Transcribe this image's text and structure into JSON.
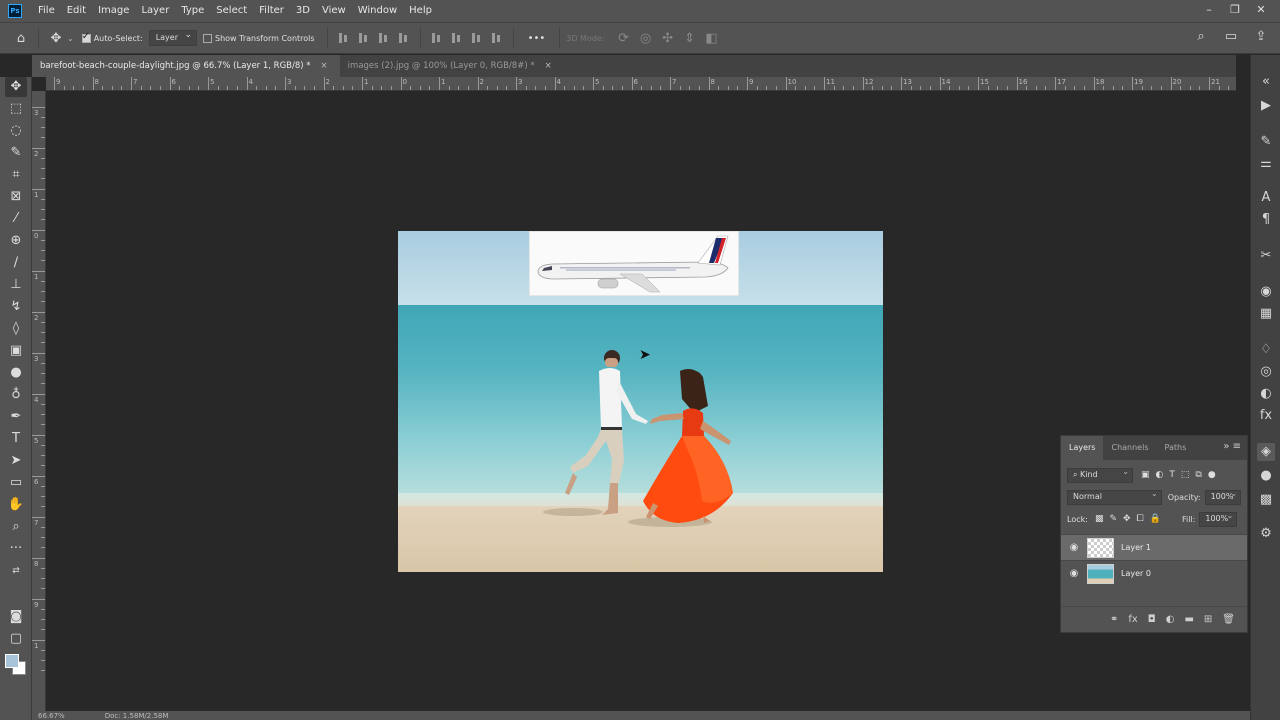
{
  "menu": [
    "File",
    "Edit",
    "Image",
    "Layer",
    "Type",
    "Select",
    "Filter",
    "3D",
    "View",
    "Window",
    "Help"
  ],
  "options_bar": {
    "auto_select_label": "Auto-Select:",
    "auto_select_value": "Layer",
    "show_transform_label": "Show Transform Controls",
    "more_label": "•••",
    "mode_3d_label": "3D Mode:"
  },
  "tabs": [
    {
      "label": "barefoot-beach-couple-daylight.jpg @ 66.7% (Layer 1, RGB/8) *",
      "close": "×"
    },
    {
      "label": "images (2).jpg @ 100% (Layer 0, RGB/8#) *",
      "close": "×"
    }
  ],
  "ruler_top": [
    "9",
    "8",
    "7",
    "6",
    "5",
    "4",
    "3",
    "2",
    "1",
    "0",
    "1",
    "2",
    "3",
    "4",
    "5",
    "6",
    "7",
    "8",
    "9",
    "10",
    "11",
    "12",
    "13",
    "14",
    "15",
    "16",
    "17",
    "18",
    "19",
    "20",
    "21"
  ],
  "ruler_left": [
    "3",
    "2",
    "1",
    "0",
    "1",
    "2",
    "3",
    "4",
    "5",
    "6",
    "7",
    "8",
    "9",
    "1"
  ],
  "layers_panel": {
    "tabs": [
      "Layers",
      "Channels",
      "Paths"
    ],
    "filter_kind": "Kind",
    "blend_mode": "Normal",
    "opacity_label": "Opacity:",
    "opacity_value": "100%",
    "lock_label": "Lock:",
    "fill_label": "Fill:",
    "fill_value": "100%",
    "layers": [
      {
        "name": "Layer 1",
        "selected": true
      },
      {
        "name": "Layer 0",
        "selected": false
      }
    ]
  },
  "status": {
    "zoom": "66.67%",
    "doc": "Doc: 1.58M/2.58M"
  },
  "colors": {
    "foreground": "#a8c4d8",
    "background": "#ffffff",
    "dress": "#ff4a10"
  }
}
